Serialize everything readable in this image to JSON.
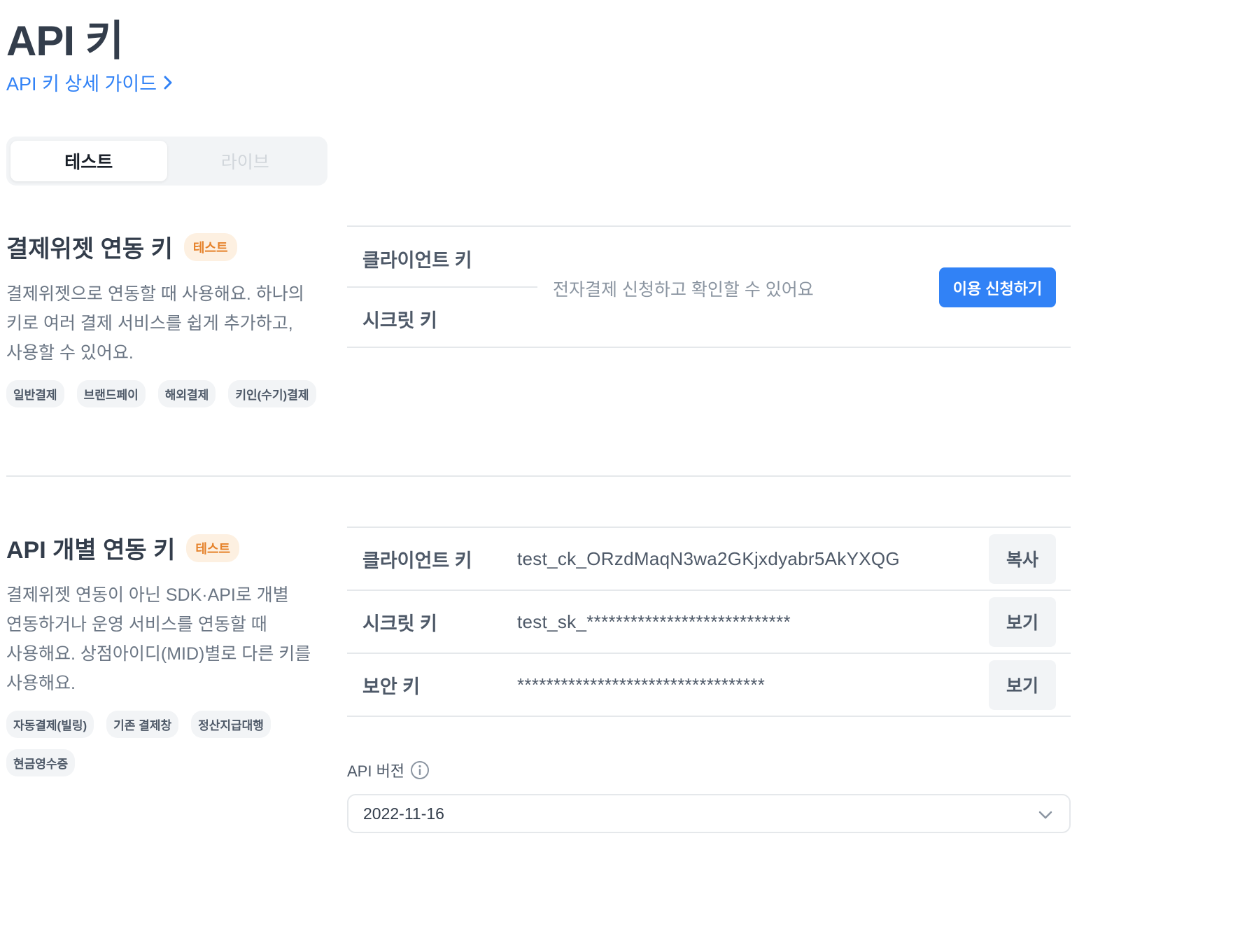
{
  "page": {
    "title": "API 키",
    "guide_link": "API 키 상세 가이드"
  },
  "env_tabs": [
    {
      "label": "테스트",
      "active": true
    },
    {
      "label": "라이브",
      "active": false
    }
  ],
  "widget_section": {
    "title": "결제위젯 연동 키",
    "badge": "테스트",
    "description_lines": [
      "결제위젯으로 연동할 때 사용해요. 하나의",
      "키로 여러 결제 서비스를 쉽게 추가하고,",
      "사용할 수 있어요."
    ],
    "chips": [
      "일반결제",
      "브랜드페이",
      "해외결제",
      "키인(수기)결제"
    ],
    "client_key_label": "클라이언트 키",
    "secret_key_label": "시크릿 키",
    "notice": "전자결제 신청하고 확인할 수 있어요",
    "apply_button": "이용 신청하기"
  },
  "api_section": {
    "title": "API 개별 연동 키",
    "badge": "테스트",
    "description_lines": [
      "결제위젯 연동이 아닌 SDK·API로 개별",
      "연동하거나 운영 서비스를 연동할 때",
      "사용해요. 상점아이디(MID)별로 다른 키를",
      "사용해요."
    ],
    "chips": [
      "자동결제(빌링)",
      "기존 결제창",
      "정산지급대행",
      "현금영수증"
    ],
    "keys": [
      {
        "label": "클라이언트 키",
        "value": "test_ck_ORzdMaqN3wa2GKjxdyabr5AkYXQG",
        "button": "복사"
      },
      {
        "label": "시크릿 키",
        "value": "test_sk_****************************",
        "button": "보기"
      },
      {
        "label": "보안 키",
        "value": "**********************************",
        "button": "보기"
      }
    ],
    "version_label": "API 버전",
    "version_value": "2022-11-16"
  },
  "colors": {
    "accent": "#3182f6",
    "badge_text": "#e5822b",
    "badge_bg": "#fdf0e1",
    "divider": "#e5e8eb"
  },
  "icons": {
    "guide_link": "chevron-right-icon",
    "version_info": "info-icon",
    "select": "chevron-down-icon"
  }
}
